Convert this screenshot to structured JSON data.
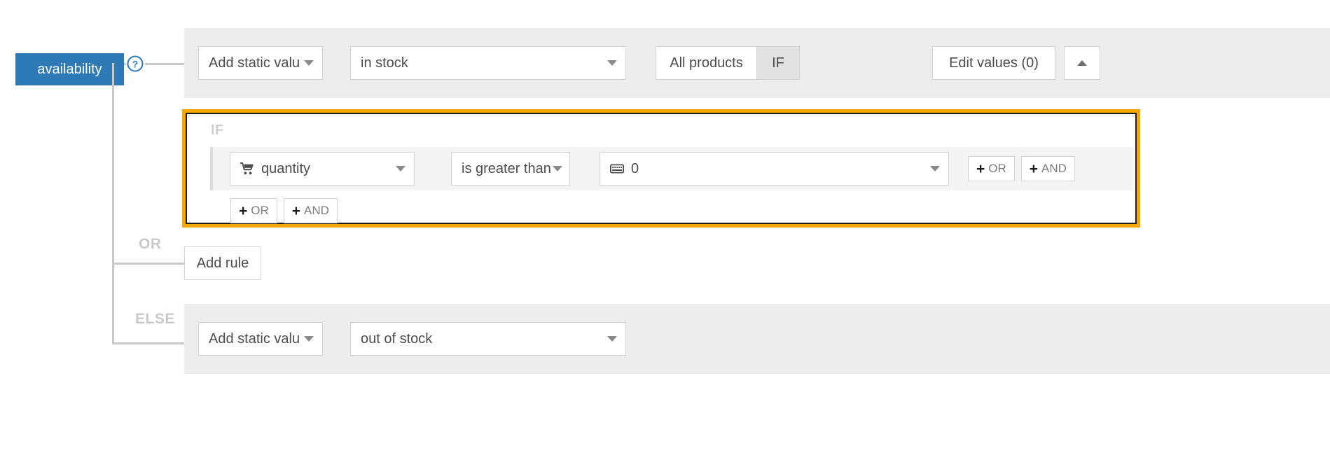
{
  "attribute": {
    "name": "availability",
    "help_icon": "question-circle-icon"
  },
  "tree": {
    "branch_or_label": "OR",
    "branch_else_label": "ELSE"
  },
  "main_row": {
    "value_source": {
      "label": "Add static valu",
      "caret_icon": "chevron-down-icon"
    },
    "value": {
      "label": "in stock",
      "caret_icon": "chevron-down-icon"
    },
    "scope_toggle": {
      "all_products_label": "All products",
      "if_label": "IF",
      "active": "IF"
    },
    "edit_values_label": "Edit values (0)",
    "collapse_icon": "chevron-up-icon"
  },
  "if_block": {
    "title": "IF",
    "highlight_color": "#f5a800",
    "condition": {
      "field": {
        "icon": "shopping-cart-icon",
        "label": "quantity",
        "caret_icon": "chevron-down-icon"
      },
      "operator": {
        "label": "is greater than",
        "caret_icon": "chevron-down-icon"
      },
      "value": {
        "icon": "keyboard-icon",
        "label": "0",
        "caret_icon": "chevron-down-icon"
      },
      "add_or_label": "OR",
      "add_and_label": "AND",
      "plus_glyph": "+"
    },
    "footer": {
      "add_or_label": "OR",
      "add_and_label": "AND",
      "plus_glyph": "+"
    }
  },
  "or_row": {
    "add_rule_label": "Add rule"
  },
  "else_row": {
    "value_source": {
      "label": "Add static valu",
      "caret_icon": "chevron-down-icon"
    },
    "value": {
      "label": "out of stock",
      "caret_icon": "chevron-down-icon"
    }
  },
  "colors": {
    "badge_blue": "#2e7ab7",
    "highlight_orange": "#f5a800",
    "panel_grey": "#ededed"
  }
}
